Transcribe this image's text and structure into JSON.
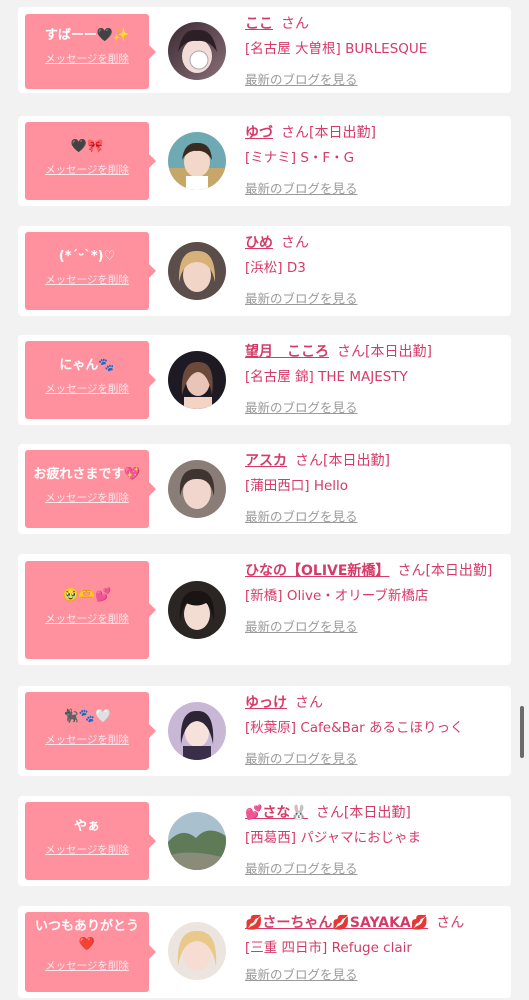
{
  "delete_label": "メッセージを削除",
  "blog_label": "最新のブログを見る",
  "san_label": "さん",
  "colors": {
    "bubble": "#ff919f",
    "accent": "#d63a68",
    "muted": "#9a9a9a",
    "background": "#f2f2f2"
  },
  "items": [
    {
      "message": "すばーー🖤✨",
      "name": "ここ",
      "work": "",
      "shop": "[名古屋 大曽根] BURLESQUE"
    },
    {
      "message": "🖤🎀",
      "name": "ゆづ",
      "work": "[本日出勤]",
      "shop": "[ミナミ] S・F・G"
    },
    {
      "message": "(*ˊᵕˋ*)♡",
      "name": "ひめ",
      "work": "",
      "shop": "[浜松] D3"
    },
    {
      "message": "にゃん🐾",
      "name": "望月　こころ",
      "work": "[本日出勤]",
      "shop": "[名古屋 錦] THE MAJESTY"
    },
    {
      "message": "お疲れさまです💖",
      "name": "アスカ",
      "work": "[本日出勤]",
      "shop": "[蒲田西口] Hello"
    },
    {
      "message": "🥹🫶💕",
      "name": "ひなの【OLIVE新橋】",
      "work": "[本日出勤]",
      "shop": "[新橋] Olive・オリーブ新橋店"
    },
    {
      "message": "🐈‍⬛🐾🤍",
      "name": "ゆっけ",
      "work": "",
      "shop": "[秋葉原] Cafe&Bar あるこほりっく"
    },
    {
      "message": "やぁ",
      "name": "💕さな🐰",
      "work": "[本日出勤]",
      "shop": "[西葛西] パジャマにおじゃま"
    },
    {
      "message": "いつもありがとう\n❤️",
      "name": "💋さーちゃん💋SAYAKA💋",
      "work": "",
      "shop": "[三重 四日市] Refuge clair"
    }
  ]
}
